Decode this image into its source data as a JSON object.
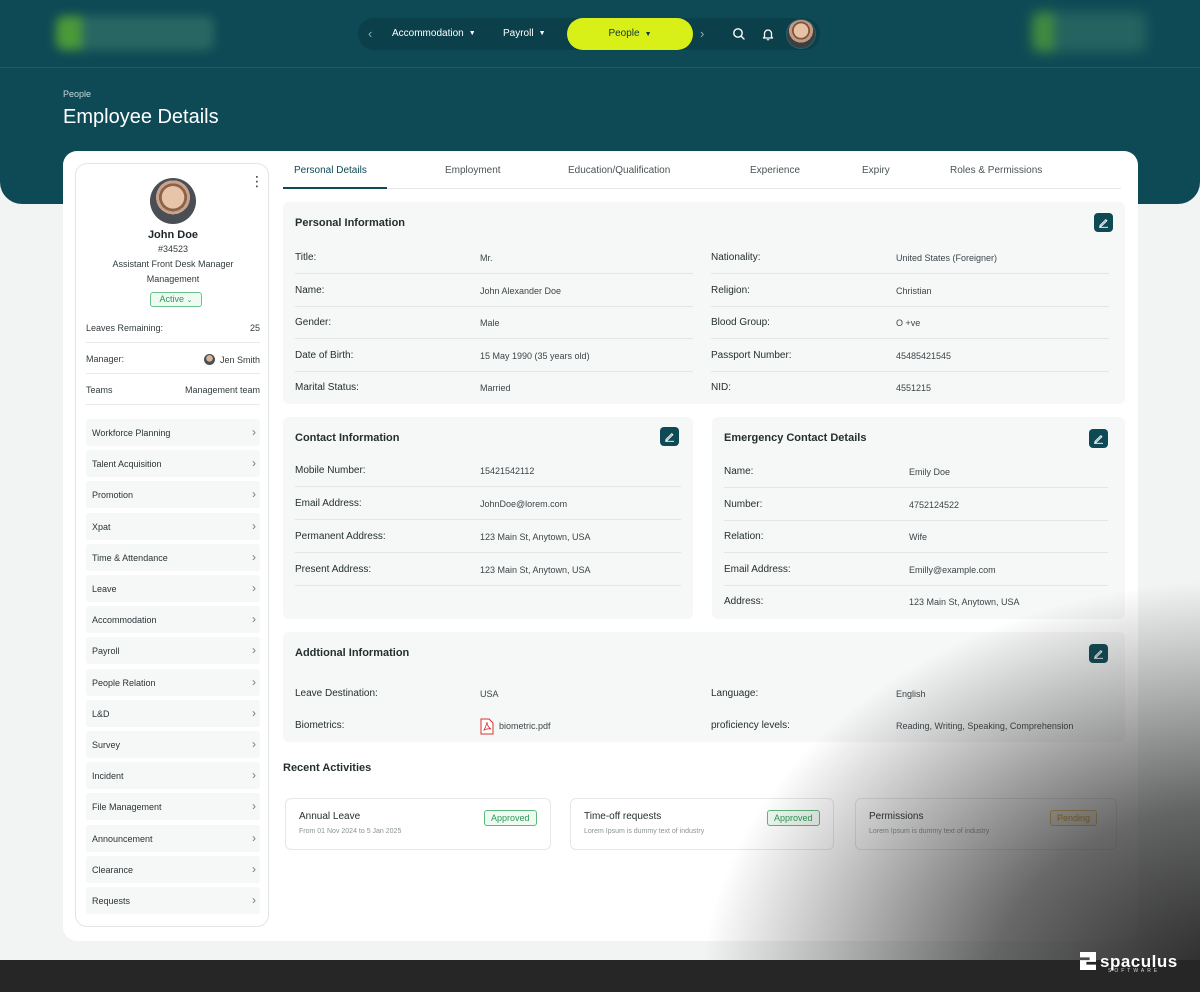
{
  "header": {
    "nav": {
      "items": [
        {
          "label": "Accommodation"
        },
        {
          "label": "Payroll"
        }
      ],
      "active": "People"
    },
    "breadcrumb": "People",
    "title": "Employee Details"
  },
  "profile": {
    "name": "John Doe",
    "id": "#34523",
    "role": "Assistant Front Desk Manager",
    "department": "Management",
    "status": "Active",
    "rows": [
      {
        "label": "Leaves Remaining:",
        "value": "25"
      },
      {
        "label": "Manager:",
        "value": "Jen Smith"
      },
      {
        "label": "Teams",
        "value": "Management team"
      }
    ],
    "menu": [
      "Workforce Planning",
      "Talent Acquisition",
      "Promotion",
      "Xpat",
      "Time & Attendance",
      "Leave",
      "Accommodation",
      "Payroll",
      "People Relation",
      "L&D",
      "Survey",
      "Incident",
      "File Management",
      "Announcement",
      "Clearance",
      "Requests"
    ]
  },
  "tabs": [
    "Personal Details",
    "Employment",
    "Education/Qualification",
    "Experience",
    "Expiry",
    "Roles & Permissions"
  ],
  "personal": {
    "title": "Personal Information",
    "left": [
      {
        "label": "Title:",
        "value": "Mr."
      },
      {
        "label": "Name:",
        "value": "John Alexander Doe"
      },
      {
        "label": "Gender:",
        "value": "Male"
      },
      {
        "label": "Date of Birth:",
        "value": "15 May 1990 (35 years old)"
      },
      {
        "label": "Marital Status:",
        "value": "Married"
      }
    ],
    "right": [
      {
        "label": "Nationality:",
        "value": "United States (Foreigner)"
      },
      {
        "label": "Religion:",
        "value": "Christian"
      },
      {
        "label": "Blood Group:",
        "value": "O +ve"
      },
      {
        "label": "Passport Number:",
        "value": "45485421545"
      },
      {
        "label": "NID:",
        "value": "4551215"
      }
    ]
  },
  "contact": {
    "title": "Contact Information",
    "rows": [
      {
        "label": "Mobile Number:",
        "value": "15421542112"
      },
      {
        "label": "Email Address:",
        "value": "JohnDoe@lorem.com"
      },
      {
        "label": "Permanent Address:",
        "value": "123 Main St, Anytown, USA"
      },
      {
        "label": "Present Address:",
        "value": "123 Main St, Anytown, USA"
      }
    ]
  },
  "emergency": {
    "title": "Emergency Contact Details",
    "rows": [
      {
        "label": "Name:",
        "value": "Emily Doe"
      },
      {
        "label": "Number:",
        "value": "4752124522"
      },
      {
        "label": "Relation:",
        "value": "Wife"
      },
      {
        "label": "Email Address:",
        "value": "Emilly@example.com"
      },
      {
        "label": "Address:",
        "value": "123 Main St, Anytown, USA"
      }
    ]
  },
  "additional": {
    "title": "Addtional Information",
    "left": [
      {
        "label": "Leave Destination:",
        "value": "USA"
      },
      {
        "label": "Biometrics:",
        "value": "biometric.pdf"
      }
    ],
    "right": [
      {
        "label": "Language:",
        "value": "English"
      },
      {
        "label": "proficiency levels:",
        "value": "Reading, Writing, Speaking, Comprehension"
      }
    ]
  },
  "recent": {
    "title": "Recent Activities",
    "cards": [
      {
        "title": "Annual Leave",
        "subtitle": "From 01 Nov 2024 to 5 Jan 2025",
        "status": "Approved"
      },
      {
        "title": "Time-off requests",
        "subtitle": "Lorem Ipsum is dummy text of industry",
        "status": "Approved"
      },
      {
        "title": "Permissions",
        "subtitle": "Lorem Ipsum is dummy text of industry",
        "status": "Pending"
      }
    ]
  },
  "brand": {
    "name": "spaculus",
    "tagline": "SOFTWARE"
  },
  "colors": {
    "primary": "#0e4a55",
    "accent": "#d8f018",
    "approved": "#2c9a56",
    "pending": "#c9962a"
  }
}
